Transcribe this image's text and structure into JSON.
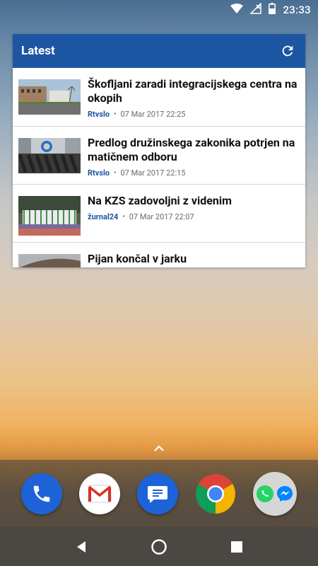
{
  "status_bar": {
    "time": "23:33",
    "icons": [
      "wifi-icon",
      "no-signal-icon",
      "battery-icon"
    ]
  },
  "widget": {
    "title": "Latest",
    "refresh_icon": "refresh-icon",
    "items": [
      {
        "headline": "Škofljani zaradi integracijskega centra na okopih",
        "source": "Rtvslo",
        "date": "07 Mar 2017 22:25"
      },
      {
        "headline": "Predlog družinskega zakonika potrjen na matičnem odboru",
        "source": "Rtvslo",
        "date": "07 Mar 2017 22:15"
      },
      {
        "headline": "Na KZS zadovoljni z videnim",
        "source": "žurnal24",
        "date": "07 Mar 2017 22:07"
      },
      {
        "headline": "Pijan končal v jarku",
        "source": "",
        "date": ""
      }
    ],
    "separator": "•"
  },
  "home": {
    "expand_icon": "chevron-up-icon",
    "dock_apps": [
      {
        "name": "Phone",
        "icon": "phone-icon"
      },
      {
        "name": "Gmail",
        "icon": "gmail-icon"
      },
      {
        "name": "Messages",
        "icon": "messages-icon"
      },
      {
        "name": "Chrome",
        "icon": "chrome-icon"
      },
      {
        "name": "Folder",
        "icon": "folder-icon"
      }
    ]
  },
  "nav": {
    "back_icon": "back-icon",
    "home_icon": "home-icon",
    "recents_icon": "recents-icon"
  },
  "colors": {
    "header": "#1c56a2",
    "source": "#1c56a2"
  }
}
